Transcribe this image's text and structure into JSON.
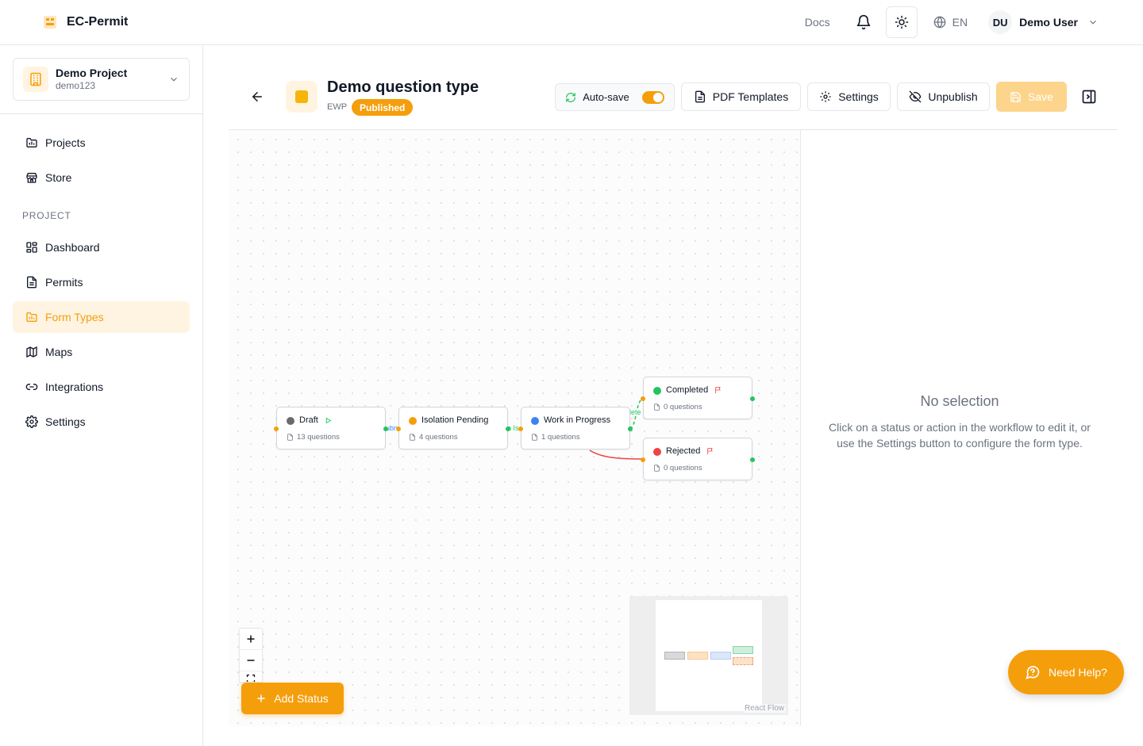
{
  "app": {
    "name": "EC-Permit"
  },
  "topbar": {
    "docs_label": "Docs",
    "language": "EN",
    "user_initials": "DU",
    "user_name": "Demo User"
  },
  "sidebar": {
    "project": {
      "name": "Demo Project",
      "code": "demo123"
    },
    "top_items": [
      {
        "label": "Projects",
        "icon": "folder-icon"
      },
      {
        "label": "Store",
        "icon": "store-icon"
      }
    ],
    "section_label": "PROJECT",
    "project_items": [
      {
        "label": "Dashboard",
        "icon": "dashboard-icon"
      },
      {
        "label": "Permits",
        "icon": "document-icon"
      },
      {
        "label": "Form Types",
        "icon": "folder-chart-icon",
        "active": true
      },
      {
        "label": "Maps",
        "icon": "map-icon"
      },
      {
        "label": "Integrations",
        "icon": "link-icon"
      },
      {
        "label": "Settings",
        "icon": "gear-icon"
      }
    ]
  },
  "form_type": {
    "title": "Demo question type",
    "code": "EWP",
    "status": "Published"
  },
  "toolbar": {
    "autosave_label": "Auto-save",
    "autosave_on": true,
    "pdf_label": "PDF Templates",
    "settings_label": "Settings",
    "unpublish_label": "Unpublish",
    "save_label": "Save"
  },
  "workflow": {
    "nodes": [
      {
        "title": "Draft",
        "questions": "13 questions",
        "color": "#6b6b6b",
        "marker": "start"
      },
      {
        "title": "Isolation Pending",
        "questions": "4 questions",
        "color": "#f59e0b"
      },
      {
        "title": "Work in Progress",
        "questions": "1 questions",
        "color": "#3b82f6"
      },
      {
        "title": "Completed",
        "questions": "0 questions",
        "color": "#22c55e",
        "marker": "end"
      },
      {
        "title": "Rejected",
        "questions": "0 questions",
        "color": "#ef4444",
        "marker": "end"
      }
    ],
    "edge_labels": [
      "ubn",
      "n Is",
      "lete"
    ],
    "add_status_label": "Add Status",
    "attribution": "React Flow"
  },
  "right_panel": {
    "title": "No selection",
    "text": "Click on a status or action in the workflow to edit it, or use the Settings button to configure the form type."
  },
  "help": {
    "label": "Need Help?"
  },
  "colors": {
    "accent": "#f59e0b",
    "accent_light": "#fff4e2"
  }
}
